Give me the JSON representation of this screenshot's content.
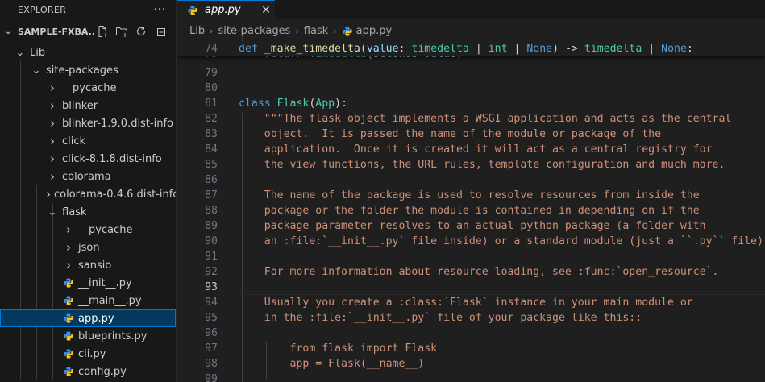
{
  "sidebar": {
    "title": "EXPLORER",
    "more_label": "···",
    "folder_title": "SAMPLE-FXBA...",
    "actions": [
      "new-file-icon",
      "new-folder-icon",
      "refresh-icon",
      "collapse-all-icon"
    ],
    "tree": [
      {
        "label": "Lib",
        "depth": 0,
        "kind": "folder-open"
      },
      {
        "label": "site-packages",
        "depth": 1,
        "kind": "folder-open"
      },
      {
        "label": "__pycache__",
        "depth": 2,
        "kind": "folder-closed"
      },
      {
        "label": "blinker",
        "depth": 2,
        "kind": "folder-closed"
      },
      {
        "label": "blinker-1.9.0.dist-info",
        "depth": 2,
        "kind": "folder-closed"
      },
      {
        "label": "click",
        "depth": 2,
        "kind": "folder-closed"
      },
      {
        "label": "click-8.1.8.dist-info",
        "depth": 2,
        "kind": "folder-closed"
      },
      {
        "label": "colorama",
        "depth": 2,
        "kind": "folder-closed"
      },
      {
        "label": "colorama-0.4.6.dist-info",
        "depth": 2,
        "kind": "folder-closed"
      },
      {
        "label": "flask",
        "depth": 2,
        "kind": "folder-open"
      },
      {
        "label": "__pycache__",
        "depth": 3,
        "kind": "folder-closed"
      },
      {
        "label": "json",
        "depth": 3,
        "kind": "folder-closed"
      },
      {
        "label": "sansio",
        "depth": 3,
        "kind": "folder-closed"
      },
      {
        "label": "__init__.py",
        "depth": 3,
        "kind": "python-file"
      },
      {
        "label": "__main__.py",
        "depth": 3,
        "kind": "python-file"
      },
      {
        "label": "app.py",
        "depth": 3,
        "kind": "python-file",
        "selected": true
      },
      {
        "label": "blueprints.py",
        "depth": 3,
        "kind": "python-file"
      },
      {
        "label": "cli.py",
        "depth": 3,
        "kind": "python-file"
      },
      {
        "label": "config.py",
        "depth": 3,
        "kind": "python-file"
      }
    ]
  },
  "editor": {
    "tab": {
      "label": "app.py",
      "close": "✕"
    },
    "breadcrumb": [
      "Lib",
      "site-packages",
      "flask",
      "app.py"
    ],
    "current_line": 93,
    "lines": [
      {
        "n": "74",
        "tokens": [
          [
            "kw",
            "def "
          ],
          [
            "fn",
            "_make_timedelta"
          ],
          [
            "plain",
            "("
          ],
          [
            "par",
            "value"
          ],
          [
            "plain",
            ": "
          ],
          [
            "cls",
            "timedelta"
          ],
          [
            "plain",
            " | "
          ],
          [
            "cls",
            "int"
          ],
          [
            "plain",
            " | "
          ],
          [
            "kw",
            "None"
          ],
          [
            "plain",
            ") -> "
          ],
          [
            "cls",
            "timedelta"
          ],
          [
            "plain",
            " | "
          ],
          [
            "kw",
            "None"
          ],
          [
            "plain",
            ":"
          ]
        ]
      },
      {
        "n": "75",
        "tokens": [
          [
            "plain",
            "    "
          ],
          [
            "kw2",
            "return "
          ],
          [
            "cls",
            "timedelta"
          ],
          [
            "plain",
            "("
          ],
          [
            "par",
            "seconds"
          ],
          [
            "plain",
            "="
          ],
          [
            "par",
            "value"
          ],
          [
            "plain",
            ")"
          ]
        ]
      },
      {
        "n": "79",
        "tokens": []
      },
      {
        "n": "80",
        "tokens": []
      },
      {
        "n": "81",
        "tokens": [
          [
            "kw",
            "class "
          ],
          [
            "cls",
            "Flask"
          ],
          [
            "plain",
            "("
          ],
          [
            "cls",
            "App"
          ],
          [
            "plain",
            "):"
          ]
        ]
      },
      {
        "n": "82",
        "tokens": [
          [
            "str",
            "    \"\"\"The flask object implements a WSGI application and acts as the central"
          ]
        ]
      },
      {
        "n": "83",
        "tokens": [
          [
            "str",
            "    object.  It is passed the name of the module or package of the"
          ]
        ]
      },
      {
        "n": "84",
        "tokens": [
          [
            "str",
            "    application.  Once it is created it will act as a central registry for"
          ]
        ]
      },
      {
        "n": "85",
        "tokens": [
          [
            "str",
            "    the view functions, the URL rules, template configuration and much more."
          ]
        ]
      },
      {
        "n": "86",
        "tokens": []
      },
      {
        "n": "87",
        "tokens": [
          [
            "str",
            "    The name of the package is used to resolve resources from inside the"
          ]
        ]
      },
      {
        "n": "88",
        "tokens": [
          [
            "str",
            "    package or the folder the module is contained in depending on if the"
          ]
        ]
      },
      {
        "n": "89",
        "tokens": [
          [
            "str",
            "    package parameter resolves to an actual python package (a folder with"
          ]
        ]
      },
      {
        "n": "90",
        "tokens": [
          [
            "str",
            "    an :file:`__init__.py` file inside) or a standard module (just a ``.py`` file)."
          ]
        ]
      },
      {
        "n": "91",
        "tokens": []
      },
      {
        "n": "92",
        "tokens": [
          [
            "str",
            "    For more information about resource loading, see :func:`open_resource`."
          ]
        ]
      },
      {
        "n": "93",
        "tokens": []
      },
      {
        "n": "94",
        "tokens": [
          [
            "str",
            "    Usually you create a :class:`Flask` instance in your main module or"
          ]
        ]
      },
      {
        "n": "95",
        "tokens": [
          [
            "str",
            "    in the :file:`__init__.py` file of your package like this::"
          ]
        ]
      },
      {
        "n": "96",
        "tokens": []
      },
      {
        "n": "97",
        "tokens": [
          [
            "str",
            "        from flask import Flask"
          ]
        ]
      },
      {
        "n": "98",
        "tokens": [
          [
            "str",
            "        app = Flask(__name__)"
          ]
        ]
      },
      {
        "n": "99",
        "tokens": []
      }
    ]
  },
  "colors": {
    "accent": "#0078d4",
    "selection": "#04395e",
    "python_icon": "#3b8eea"
  }
}
